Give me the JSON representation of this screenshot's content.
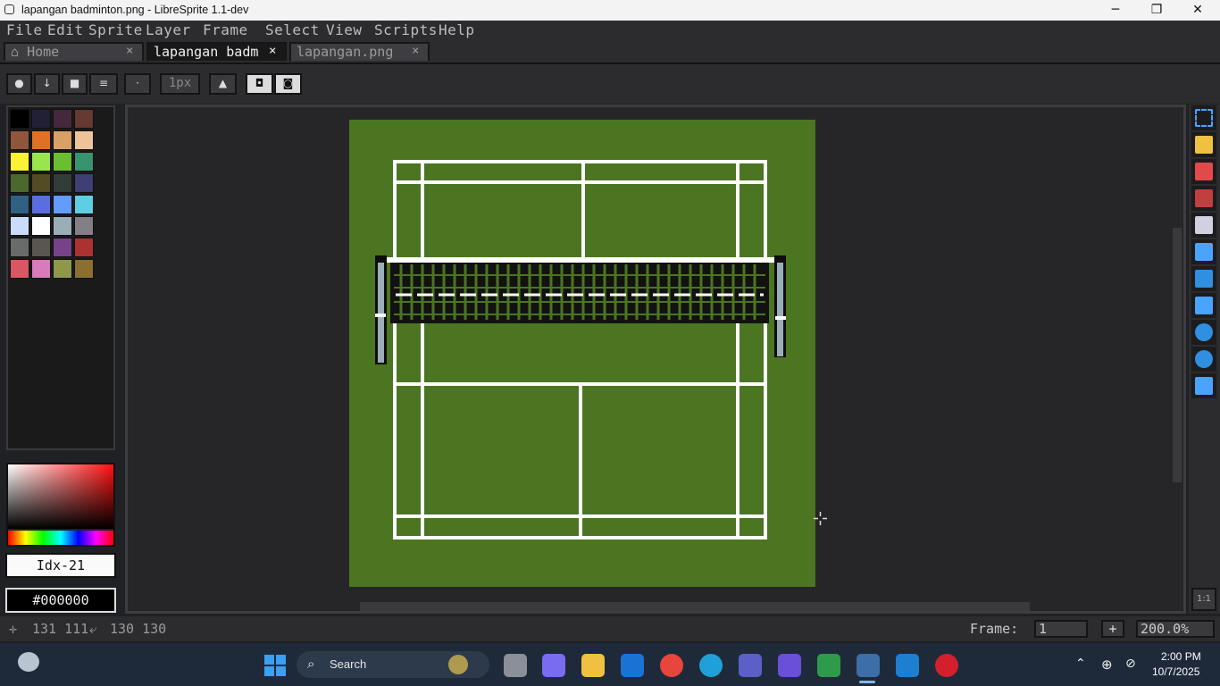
{
  "window": {
    "title": "lapangan badminton.png - LibreSprite 1.1-dev"
  },
  "menu": [
    "File",
    "Edit",
    "Sprite",
    "Layer",
    "Frame",
    "Select",
    "View",
    "Scripts",
    "Help"
  ],
  "tabs": [
    {
      "label": "Home",
      "close": "×"
    },
    {
      "label": "lapangan badm",
      "close": "×"
    },
    {
      "label": "lapangan.png",
      "close": "×"
    }
  ],
  "context_bar": {
    "brush_size": "1px"
  },
  "palette": {
    "colors": [
      "#000000",
      "#222034",
      "#45283c",
      "#663931",
      "#8f563b",
      "#df7126",
      "#d9a066",
      "#eec39a",
      "#fbf236",
      "#99e550",
      "#6abe30",
      "#37946e",
      "#4b692f",
      "#524b24",
      "#323c39",
      "#3f3f74",
      "#306082",
      "#5b6ee1",
      "#639bff",
      "#5fcde4",
      "#cbdbfc",
      "#ffffff",
      "#9badb7",
      "#847e87",
      "#696a6a",
      "#595652",
      "#76428a",
      "#ac3232",
      "#d95763",
      "#d77bba",
      "#8f974a",
      "#8a6f30"
    ]
  },
  "color_picker": {
    "index": "Idx-21",
    "hex": "#000000"
  },
  "status": {
    "cursor": "131 111",
    "size": "130 130",
    "frame_label": "Frame:",
    "frame_value": "1",
    "add_frame": "+",
    "zoom": "200.0%"
  },
  "tools": [
    "rectangular-marquee-icon",
    "pencil-icon",
    "eraser-icon",
    "eyedropper-icon",
    "zoom-icon",
    "move-icon",
    "paint-bucket-icon",
    "line-icon",
    "ellipse-icon",
    "contour-icon",
    "spray-icon"
  ],
  "taskbar": {
    "search_placeholder": "Search",
    "time": "2:00 PM",
    "date": "10/7/2025"
  }
}
